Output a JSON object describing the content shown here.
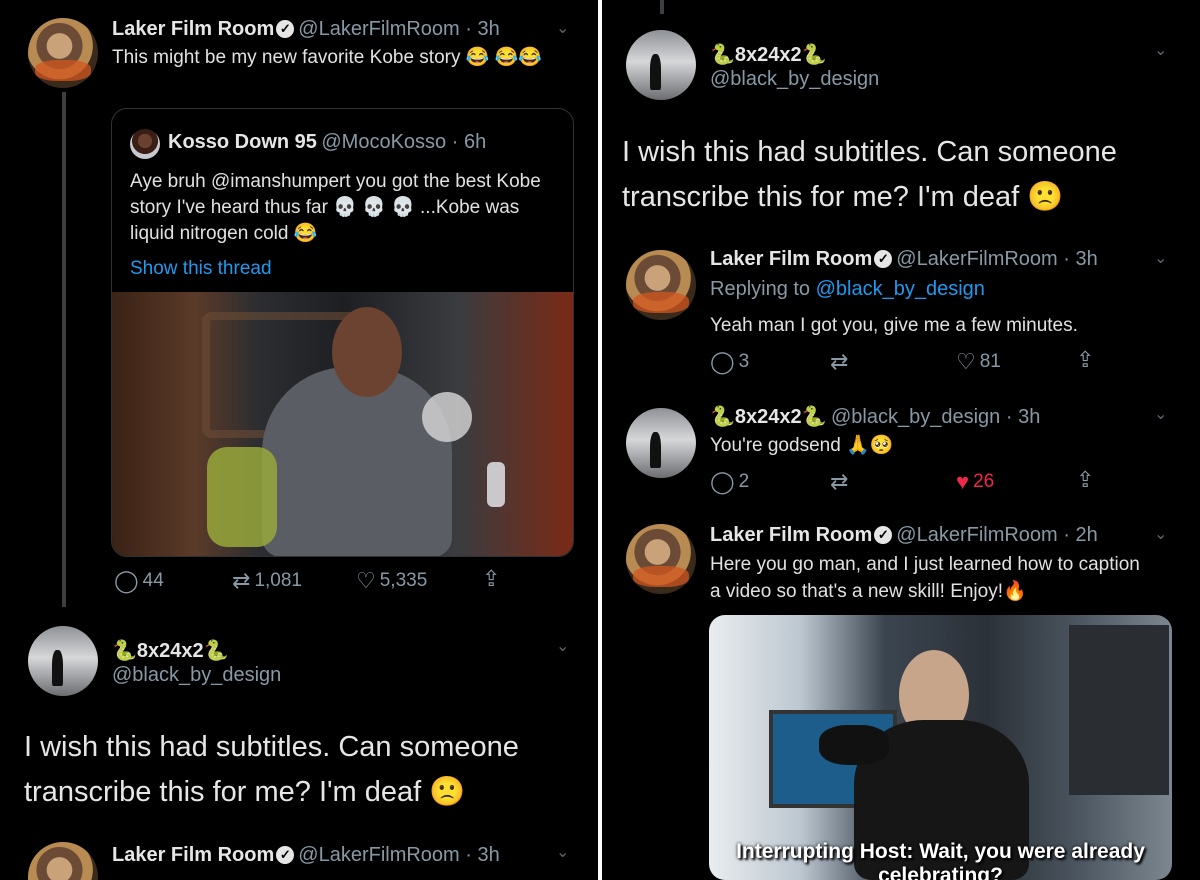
{
  "left": {
    "tweet1": {
      "name": "Laker Film Room",
      "handle": "@LakerFilmRoom · 3h",
      "text": "This might be my new favorite Kobe story 😂 😂😂",
      "quote": {
        "name": "Kosso Down 95",
        "handle": "@MocoKosso · 6h",
        "text": "Aye bruh @imanshumpert you got the best Kobe story I've heard thus far 💀 💀 💀 ...Kobe was liquid nitrogen cold 😂",
        "show_thread": "Show this thread"
      },
      "stats": {
        "replies": "44",
        "retweets": "1,081",
        "likes": "5,335"
      }
    },
    "tweet2": {
      "name": "🐍8x24x2🐍",
      "handle": "@black_by_design",
      "text": "I wish this had subtitles. Can someone transcribe this for me? I'm deaf 🙁"
    },
    "tweet3": {
      "name": "Laker Film Room",
      "handle": "@LakerFilmRoom · 3h"
    }
  },
  "right": {
    "tweet1": {
      "name": "🐍8x24x2🐍",
      "handle": "@black_by_design",
      "text": "I wish this had subtitles. Can someone transcribe this for me? I'm deaf 🙁"
    },
    "reply1": {
      "name": "Laker Film Room",
      "handle": "@LakerFilmRoom · 3h",
      "replying_prefix": "Replying to ",
      "replying_handle": "@black_by_design",
      "text": "Yeah man I got you, give me a few minutes.",
      "stats": {
        "replies": "3",
        "likes": "81"
      }
    },
    "reply2": {
      "name": "🐍8x24x2🐍",
      "handle": "@black_by_design · 3h",
      "text": "You're godsend 🙏🥺",
      "stats": {
        "replies": "2",
        "likes": "26"
      }
    },
    "reply3": {
      "name": "Laker Film Room",
      "handle": "@LakerFilmRoom · 2h",
      "text": "Here you go man, and I just learned how to caption a video so that's a new skill! Enjoy!🔥",
      "caption": "Interrupting Host: Wait, you were already celebrating?"
    }
  },
  "icons": {
    "reply": "reply-icon",
    "retweet": "retweet-icon",
    "like": "heart-icon",
    "share": "share-icon",
    "chevron": "chevron-down-icon",
    "verified": "verified-badge-icon"
  },
  "colors": {
    "background": "#000000",
    "link": "#1d9bf0",
    "liked": "#f0284a",
    "muted": "#8899a6"
  }
}
